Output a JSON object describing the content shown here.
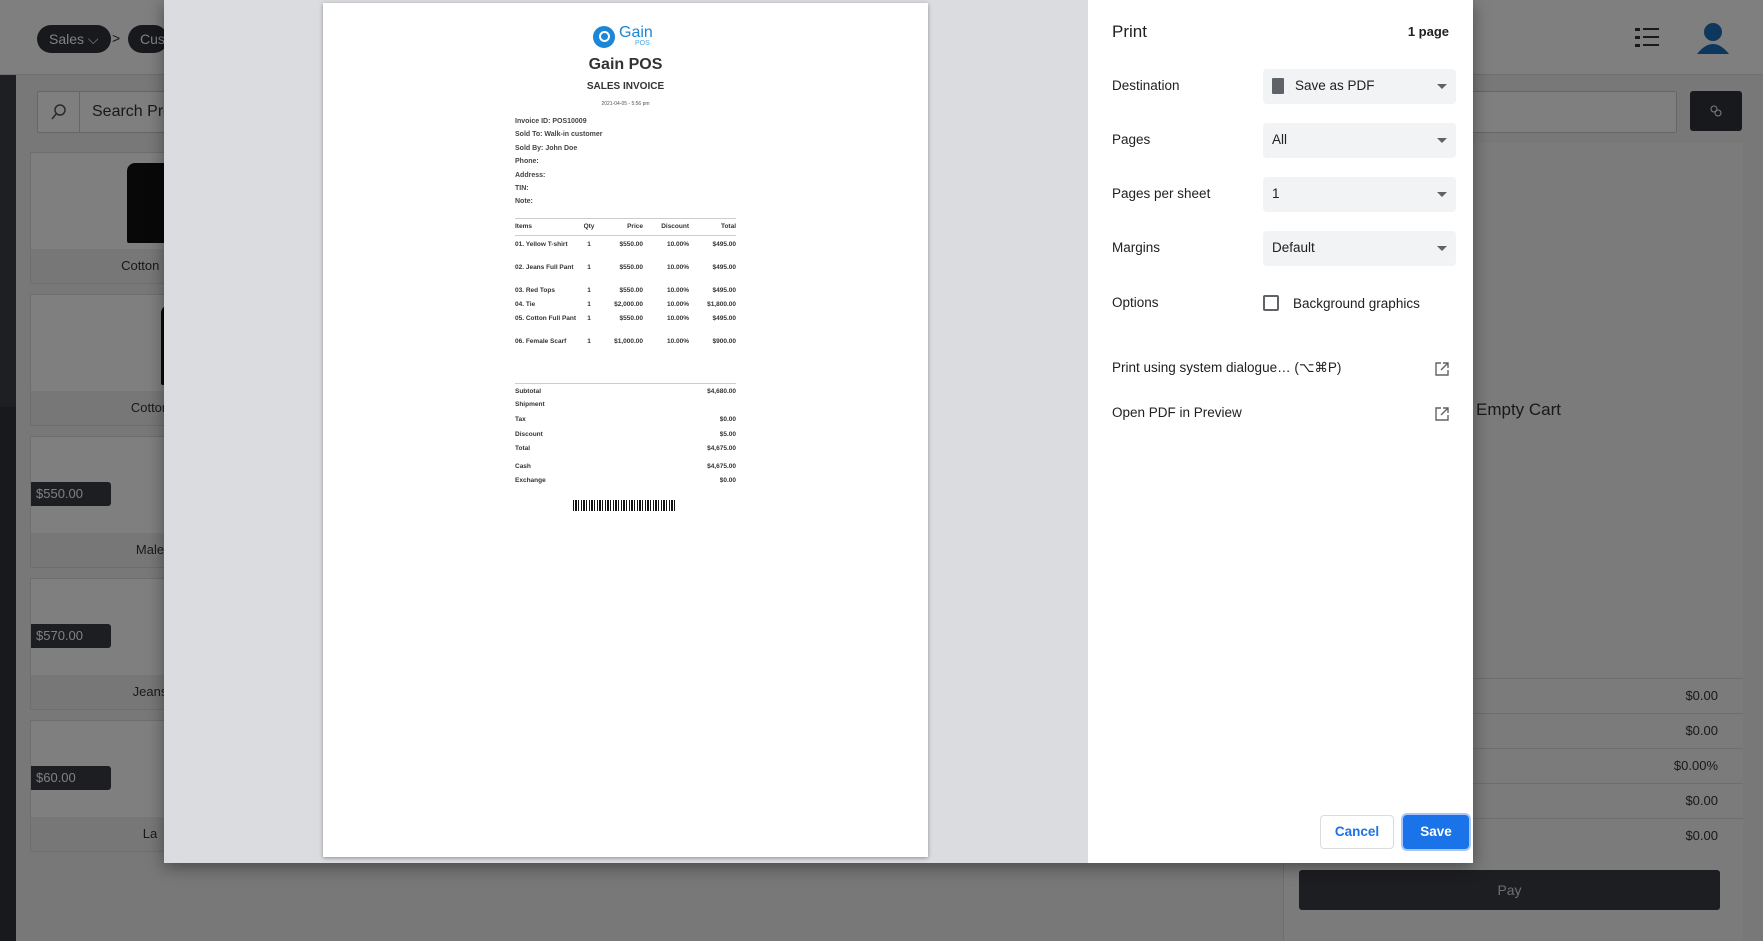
{
  "app": {
    "breadcrumb": [
      "Sales",
      "Cust"
    ],
    "breadcrumb_sep": ">",
    "search_placeholder": "Search Pro",
    "products": [
      {
        "name": "Cotton Sh",
        "price": ""
      },
      {
        "name": "Cotton",
        "price": ""
      },
      {
        "name": "Male",
        "price": "$550.00"
      },
      {
        "name": "Jeans",
        "price": "$570.00"
      },
      {
        "name": "La",
        "price": "$60.00"
      }
    ],
    "empty_cart": "Empty Cart",
    "cart_values": [
      "$0.00",
      "$0.00",
      "$0.00%",
      "$0.00",
      "$0.00"
    ],
    "pay_label": "Pay"
  },
  "invoice": {
    "logo_word": "Gain",
    "logo_sub": "POS",
    "title": "Gain POS",
    "subtitle": "SALES INVOICE",
    "date": "2021-04-05 - 5:56 pm",
    "meta": [
      "Invoice ID: POS10009",
      "Sold To: Walk-in customer",
      "Sold By: John Doe",
      "Phone:",
      "Address:",
      "TIN:",
      "Note:"
    ],
    "columns": [
      "Items",
      "Qty",
      "Price",
      "Discount",
      "Total"
    ],
    "rows": [
      {
        "item": "01. Yellow T-shirt",
        "qty": "1",
        "price": "$550.00",
        "discount": "10.00%",
        "total": "$495.00"
      },
      {
        "item": "02. Jeans Full Pant",
        "qty": "1",
        "price": "$550.00",
        "discount": "10.00%",
        "total": "$495.00"
      },
      {
        "item": "03. Red Tops",
        "qty": "1",
        "price": "$550.00",
        "discount": "10.00%",
        "total": "$495.00"
      },
      {
        "item": "04. Tie",
        "qty": "1",
        "price": "$2,000.00",
        "discount": "10.00%",
        "total": "$1,800.00"
      },
      {
        "item": "05. Cotton Full Pant",
        "qty": "1",
        "price": "$550.00",
        "discount": "10.00%",
        "total": "$495.00"
      },
      {
        "item": "06. Female Scarf",
        "qty": "1",
        "price": "$1,000.00",
        "discount": "10.00%",
        "total": "$900.00"
      }
    ],
    "totals": [
      {
        "label": "Subtotal",
        "value": "$4,680.00"
      },
      {
        "label": "Shipment",
        "value": ""
      },
      {
        "label": "Tax",
        "value": "$0.00"
      },
      {
        "label": "Discount",
        "value": "$5.00"
      },
      {
        "label": "Total",
        "value": "$4,675.00"
      },
      {
        "label": "Cash",
        "value": "$4,675.00"
      },
      {
        "label": "Exchange",
        "value": "$0.00"
      }
    ]
  },
  "print": {
    "title": "Print",
    "page_count": "1 page",
    "destination_label": "Destination",
    "destination_value": "Save as PDF",
    "pages_label": "Pages",
    "pages_value": "All",
    "pps_label": "Pages per sheet",
    "pps_value": "1",
    "margins_label": "Margins",
    "margins_value": "Default",
    "options_label": "Options",
    "bg_graphics_label": "Background graphics",
    "bg_graphics_checked": false,
    "system_dialog_link": "Print using system dialogue… (⌥⌘P)",
    "open_preview_link": "Open PDF in Preview",
    "cancel_label": "Cancel",
    "save_label": "Save",
    "accent_color": "#1a73e8"
  }
}
